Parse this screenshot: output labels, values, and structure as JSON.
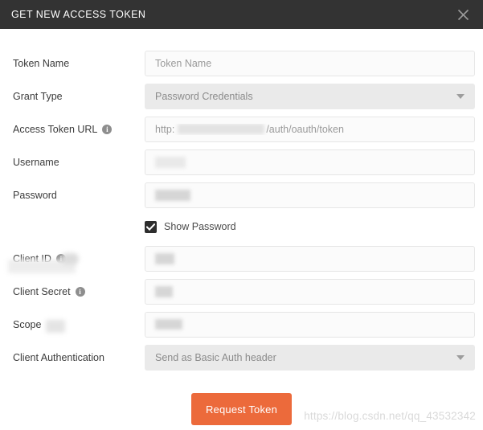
{
  "dialog": {
    "title": "GET NEW ACCESS TOKEN",
    "close_icon": "close-icon",
    "header_bg": "#333333",
    "accent": "#ec6a3b"
  },
  "fields": [
    {
      "id": "token-name",
      "label": "Token Name",
      "info": false,
      "type": "text",
      "value": "Token Name",
      "redacted": false
    },
    {
      "id": "grant-type",
      "label": "Grant Type",
      "info": false,
      "type": "select",
      "value": "Password Credentials",
      "redacted": false
    },
    {
      "id": "access-token-url",
      "label": "Access Token URL",
      "info": true,
      "type": "text",
      "value_prefix": "http:",
      "value_suffix": "/auth/oauth/token",
      "redacted": true
    },
    {
      "id": "username",
      "label": "Username",
      "info": false,
      "type": "text",
      "value": "",
      "redacted": true
    },
    {
      "id": "password",
      "label": "Password",
      "info": false,
      "type": "text",
      "value": "",
      "redacted": true
    }
  ],
  "show_password": {
    "label": "Show Password",
    "checked": true
  },
  "fields2": [
    {
      "id": "client-id",
      "label": "Client ID",
      "info": true,
      "type": "text",
      "value": "",
      "redacted": true
    },
    {
      "id": "client-secret",
      "label": "Client Secret",
      "info": true,
      "type": "text",
      "value": "",
      "redacted": true
    },
    {
      "id": "scope",
      "label": "Scope",
      "info": false,
      "type": "text",
      "value": "",
      "redacted": true
    },
    {
      "id": "client-authentication",
      "label": "Client Authentication",
      "info": false,
      "type": "select",
      "value": "Send as Basic Auth header",
      "redacted": false
    }
  ],
  "actions": {
    "request_token_label": "Request Token"
  },
  "watermark": {
    "text": "https://blog.csdn.net/qq_43532342"
  }
}
